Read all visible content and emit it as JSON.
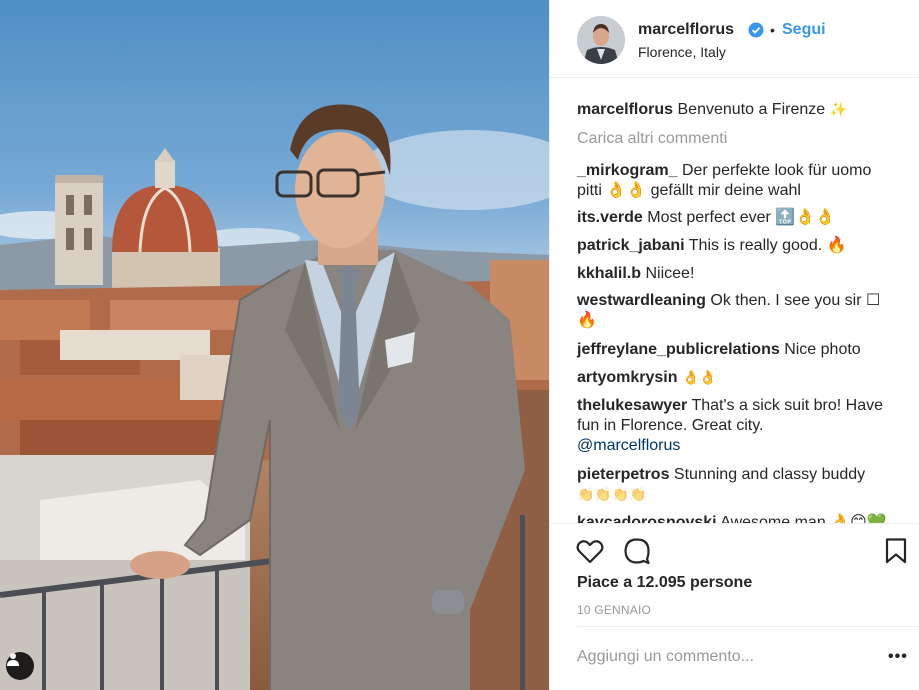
{
  "post": {
    "username": "marcelflorus",
    "follow_label": "Segui",
    "separator": "•",
    "location": "Florence, Italy"
  },
  "caption": {
    "username": "marcelflorus",
    "text": "Benvenuto a Firenze",
    "emoji": "✨"
  },
  "load_more": "Carica altri commenti",
  "comments": [
    {
      "username": "_mirkogram_",
      "text": "Der perfekte look für uomo pitti 👌👌 gefällt mir deine wahl"
    },
    {
      "username": "its.verde",
      "text": "Most perfect ever 🔝👌👌"
    },
    {
      "username": "patrick_jabani",
      "text": "This is really good. 🔥"
    },
    {
      "username": "kkhalil.b",
      "text": "Niicee!"
    },
    {
      "username": "westwardleaning",
      "text": "Ok then. I see you sir ☐ 🔥"
    },
    {
      "username": "jeffreylane_publicrelations",
      "text": "Nice photo"
    },
    {
      "username": "artyomkrysin",
      "text": "👌👌"
    },
    {
      "username": "thelukesawyer",
      "text": "That's a sick suit bro! Have fun in Florence. Great city.",
      "mention": "@marcelflorus"
    },
    {
      "username": "pieterpetros",
      "text": "Stunning and classy buddy",
      "emoji": "👏👏👏👏"
    },
    {
      "username": "kavcadorosnovski",
      "text": "Awesome man 👌😊💚"
    }
  ],
  "actions": {
    "like_icon": "heart-icon",
    "comment_icon": "comment-icon",
    "save_icon": "bookmark-icon"
  },
  "likes_text": "Piace a 12.095 persone",
  "date": "10 GENNAIO",
  "add_comment_placeholder": "Aggiungi un commento...",
  "more_label": "•••",
  "colors": {
    "link_blue": "#3897f0",
    "verified_blue": "#3897f0",
    "muted": "#999999",
    "text": "#262626"
  }
}
